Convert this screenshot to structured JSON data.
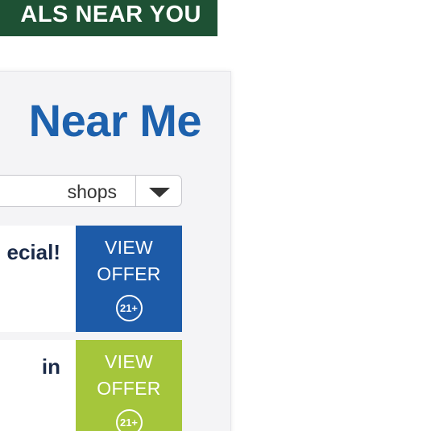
{
  "banner": {
    "text": "ALS NEAR YOU"
  },
  "widget": {
    "title": "Near Me",
    "category_select": {
      "value": "shops"
    },
    "deals": [
      {
        "title": "ecial!",
        "offer_label_line1": "VIEW",
        "offer_label_line2": "OFFER",
        "age_badge": "21+",
        "offer_color": "#1d5ba8"
      },
      {
        "title": "in",
        "offer_label_line1": "VIEW",
        "offer_label_line2": "OFFER",
        "age_badge": "21+",
        "offer_color": "#a5c63b"
      }
    ]
  },
  "colors": {
    "banner_bg": "#1e5134",
    "title_blue": "#1d61ad",
    "panel_bg": "#f4f4f6"
  },
  "icons": {
    "dropdown": "chevron-down-icon"
  }
}
